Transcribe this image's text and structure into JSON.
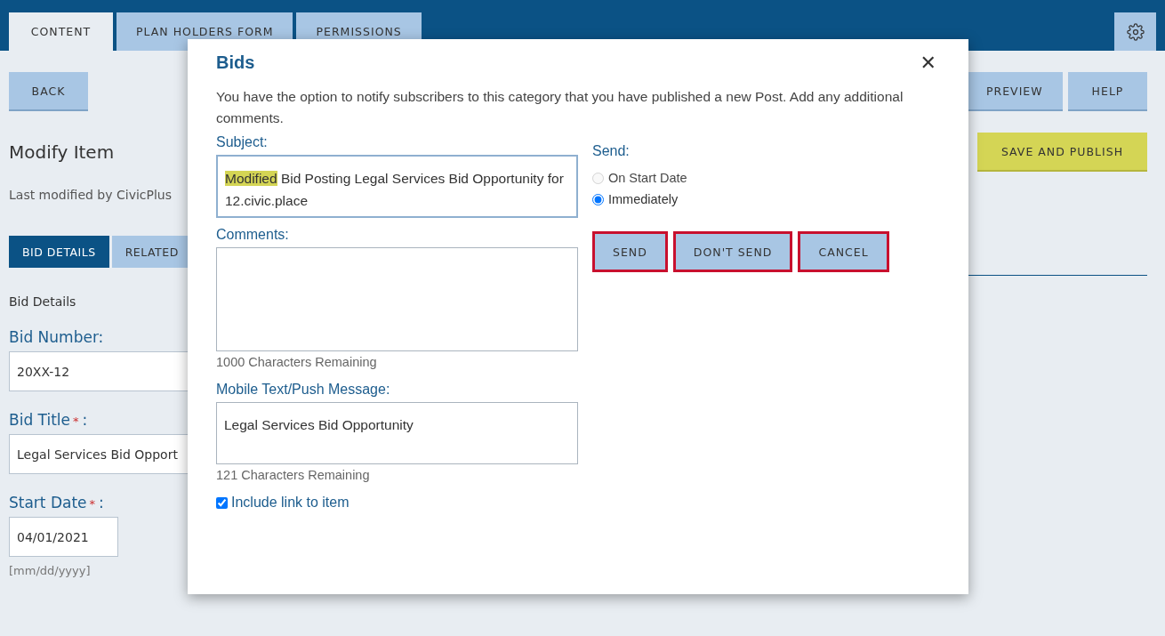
{
  "top_tabs": [
    {
      "label": "CONTENT",
      "selected": true
    },
    {
      "label": "PLAN HOLDERS FORM",
      "selected": false
    },
    {
      "label": "PERMISSIONS",
      "selected": false
    }
  ],
  "back_button": "BACK",
  "page_title": "Modify Item",
  "last_modified": "Last modified by CivicPlus",
  "section_tabs": [
    {
      "label": "BID DETAILS",
      "selected": true
    },
    {
      "label": "RELATED",
      "selected": false
    }
  ],
  "section_heading": "Bid Details",
  "fields": [
    {
      "label": "Bid Number:",
      "required": false,
      "value": "20XX-12",
      "kind": "wide"
    },
    {
      "label": "Bid Title",
      "required": true,
      "value": "Legal Services Bid Opport",
      "kind": "wide"
    },
    {
      "label": "Start Date",
      "required": true,
      "value": "04/01/2021",
      "kind": "date",
      "hint": "[mm/dd/yyyy]"
    }
  ],
  "required_mark": "*",
  "label_colon": ":",
  "header_buttons": [
    "PREVIEW",
    "HELP"
  ],
  "publish_button": "SAVE AND PUBLISH",
  "dialog": {
    "title": "Bids",
    "close": "✕",
    "description": "You have the option to notify subscribers to this category that you have published a new Post. Add any additional comments.",
    "subject_label": "Subject:",
    "subject_highlight": "Modified",
    "subject_rest": " Bid Posting Legal Services Bid Opportunity for 12.civic.place",
    "comments_label": "Comments:",
    "comments_remaining": "1000 Characters Remaining",
    "mobile_label": "Mobile Text/Push Message:",
    "mobile_value": "Legal Services Bid Opportunity",
    "mobile_remaining": "121 Characters Remaining",
    "include_link": {
      "label": "Include link to item",
      "checked": true
    },
    "send_label": "Send:",
    "send_options": [
      {
        "label": "On Start Date",
        "selected": false,
        "disabled": true
      },
      {
        "label": "Immediately",
        "selected": true,
        "disabled": false
      }
    ],
    "actions": [
      {
        "label": "SEND",
        "outlined": true
      },
      {
        "label": "DON'T SEND",
        "outlined": true
      },
      {
        "label": "CANCEL",
        "outlined": true
      }
    ]
  }
}
